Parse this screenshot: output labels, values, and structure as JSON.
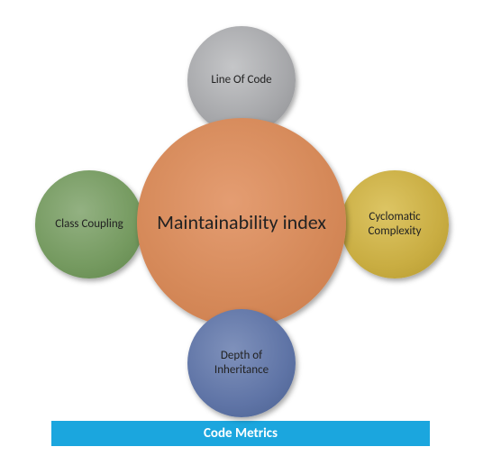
{
  "diagram": {
    "center": {
      "label": "Maintainability index"
    },
    "top": {
      "label": "Line Of Code"
    },
    "right": {
      "label": "Cyclomatic Complexity"
    },
    "bottom": {
      "label": "Depth of Inheritance"
    },
    "left": {
      "label": "Class Coupling"
    }
  },
  "title_bar": {
    "label": "Code Metrics"
  },
  "colors": {
    "center": "#d68a5a",
    "top": "#a6a7aa",
    "right": "#c9ad42",
    "bottom": "#5f74a6",
    "left": "#759a60",
    "bar": "#1ba6de"
  }
}
